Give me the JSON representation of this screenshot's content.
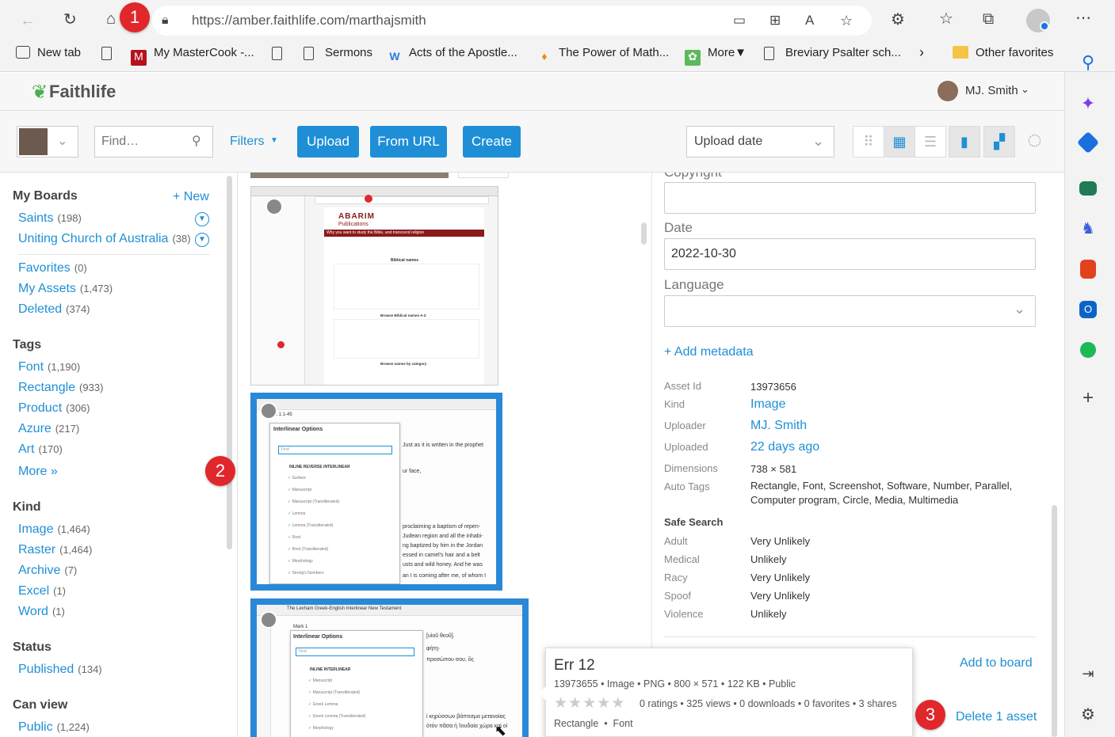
{
  "browser": {
    "url": "https://amber.faithlife.com/marthajsmith",
    "bookmarks": [
      "New tab",
      "My MasterCook -...",
      "Sermons",
      "Acts of the Apostle...",
      "The Power of Math...",
      "More▼",
      "Breviary Psalter sch...",
      "Other favorites"
    ]
  },
  "annotations": [
    "1",
    "2",
    "3"
  ],
  "app": {
    "logo": "Faithlife",
    "user": "MJ. Smith",
    "search_placeholder": "Find…",
    "filters_label": "Filters",
    "upload_label": "Upload",
    "from_url_label": "From URL",
    "create_label": "Create",
    "sort_value": "Upload date"
  },
  "nav": {
    "my_boards": {
      "title": "My Boards",
      "new_label": "+ New",
      "items": [
        {
          "label": "Saints",
          "count": "(198)"
        },
        {
          "label": "Uniting Church of Australia",
          "count": "(38)"
        }
      ]
    },
    "collections": [
      {
        "label": "Favorites",
        "count": "(0)"
      },
      {
        "label": "My Assets",
        "count": "(1,473)"
      },
      {
        "label": "Deleted",
        "count": "(374)"
      }
    ],
    "tags": {
      "title": "Tags",
      "items": [
        {
          "label": "Font",
          "count": "(1,190)"
        },
        {
          "label": "Rectangle",
          "count": "(933)"
        },
        {
          "label": "Product",
          "count": "(306)"
        },
        {
          "label": "Azure",
          "count": "(217)"
        },
        {
          "label": "Art",
          "count": "(170)"
        }
      ],
      "more": "More »"
    },
    "kind": {
      "title": "Kind",
      "items": [
        {
          "label": "Image",
          "count": "(1,464)"
        },
        {
          "label": "Raster",
          "count": "(1,464)"
        },
        {
          "label": "Archive",
          "count": "(7)"
        },
        {
          "label": "Excel",
          "count": "(1)"
        },
        {
          "label": "Word",
          "count": "(1)"
        }
      ]
    },
    "status": {
      "title": "Status",
      "items": [
        {
          "label": "Published",
          "count": "(134)"
        }
      ]
    },
    "can_view": {
      "title": "Can view",
      "items": [
        {
          "label": "Public",
          "count": "(1,224)"
        }
      ]
    }
  },
  "thumbs": {
    "t1": {
      "title": "ABARIM",
      "subtitle": "Publications",
      "tagline": "Why you want to study the Bible, and transcend religion",
      "heading": "Biblical names",
      "sub2": "Browse Biblical names A-Z",
      "sub3": "Browse names by category"
    },
    "t2": {
      "ref": "Mk 1:1-45",
      "panel_title": "Interlinear Options",
      "find": "Find",
      "group": "INLINE REVERSE INTERLINEAR",
      "options": [
        "Surface",
        "Manuscript",
        "Manuscript (Transliterated)",
        "Lemma",
        "Lemma (Transliterated)",
        "Root",
        "Root (Transliterated)",
        "Morphology",
        "Strong's Numbers"
      ],
      "side_text": [
        "Just as it is written in the prophet",
        "ur face,",
        "proclaiming a baptism of repen-",
        "Judean region and all the inhabi-",
        "ng baptized by him in the Jordan",
        "essed in camel's hair and a belt",
        "usts and wild honey. And he was",
        "an I is coming after me, of whom I"
      ]
    },
    "t3": {
      "tab": "The Lexham Greek-English Interlinear New Testament",
      "ref": "Mark 1",
      "panel_title": "Interlinear Options",
      "find": "Find",
      "group": "INLINE INTERLINEAR",
      "options": [
        "Manuscript",
        "Manuscript (Transliterated)",
        "Greek Lemma",
        "Greek Lemma (Transliterated)",
        "Morphology"
      ],
      "side_text": [
        "[υἱοῦ θεοῦ].",
        "φήτῃ·",
        "προσώπου σου, ὃς",
        "ἰ κηρύσσων βάπτισμα μετανοίας",
        "ὸτὸν πᾶσα ἡ Ἰουδαία χώρα καὶ οἱ"
      ]
    }
  },
  "details": {
    "copyright_label": "Copyright",
    "date_label": "Date",
    "date_value": "2022-10-30",
    "language_label": "Language",
    "add_metadata": "+ Add metadata",
    "meta": [
      {
        "key": "Asset Id",
        "value": "13973656"
      },
      {
        "key": "Kind",
        "value": "Image"
      },
      {
        "key": "Uploader",
        "value": "MJ. Smith"
      },
      {
        "key": "Uploaded",
        "value": "22 days ago"
      },
      {
        "key": "Dimensions",
        "value": "738 × 581"
      },
      {
        "key": "Auto Tags",
        "value": "Rectangle, Font, Screenshot, Software, Number, Parallel, Computer program, Circle, Media, Multimedia"
      }
    ],
    "safe_search_title": "Safe Search",
    "safe": [
      {
        "key": "Adult",
        "value": "Very Unlikely"
      },
      {
        "key": "Medical",
        "value": "Unlikely"
      },
      {
        "key": "Racy",
        "value": "Very Unlikely"
      },
      {
        "key": "Spoof",
        "value": "Very Unlikely"
      },
      {
        "key": "Violence",
        "value": "Unlikely"
      }
    ],
    "add_to_board": "Add to board",
    "delete": "Delete 1 asset"
  },
  "popup": {
    "title": "Err 12",
    "meta": "13973655 • Image • PNG • 800 × 571 • 122 KB • Public",
    "stats": "0 ratings • 325 views • 0 downloads • 0 favorites • 3 shares",
    "tags": "Rectangle  •  Font"
  }
}
